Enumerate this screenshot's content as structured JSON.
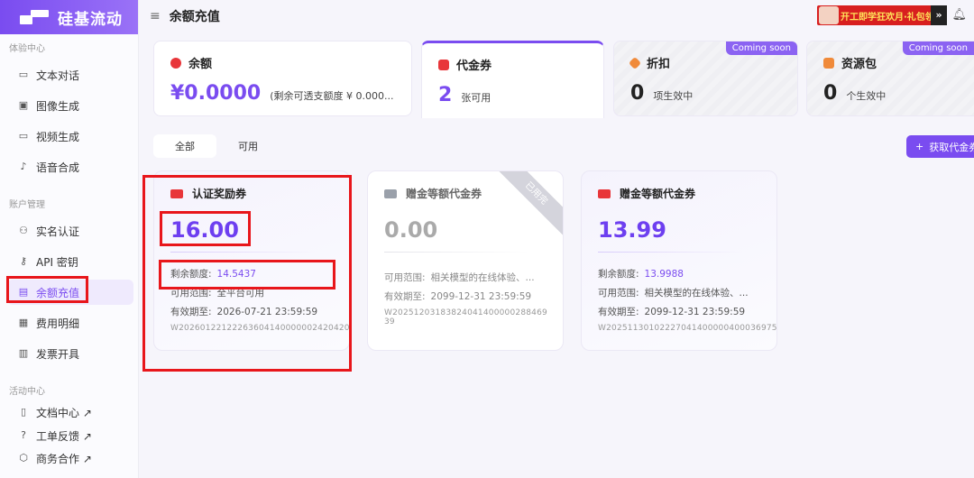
{
  "app": {
    "logo_text": "硅基流动",
    "page_title": "余额充值"
  },
  "promo": {
    "text": "开工即学狂欢月·礼包领取",
    "arrow": "»"
  },
  "sidebar": {
    "sections": [
      {
        "label": "体验中心"
      },
      {
        "label": "账户管理"
      },
      {
        "label": "活动中心"
      }
    ],
    "items": [
      {
        "label": "文本对话",
        "icon": "chat-icon"
      },
      {
        "label": "图像生成",
        "icon": "image-icon"
      },
      {
        "label": "视频生成",
        "icon": "video-icon"
      },
      {
        "label": "语音合成",
        "icon": "mic-icon"
      },
      {
        "label": "实名认证",
        "icon": "user-verify-icon"
      },
      {
        "label": "API 密钥",
        "icon": "key-icon"
      },
      {
        "label": "余额充值",
        "icon": "wallet-icon",
        "active": true
      },
      {
        "label": "费用明细",
        "icon": "bill-icon"
      },
      {
        "label": "发票开具",
        "icon": "invoice-icon"
      },
      {
        "label": "文档中心 ↗",
        "icon": "doc-icon"
      },
      {
        "label": "工单反馈 ↗",
        "icon": "help-icon"
      },
      {
        "label": "商务合作 ↗",
        "icon": "handshake-icon"
      }
    ]
  },
  "summary": {
    "balance": {
      "title": "余额",
      "amount": "¥0.0000",
      "note": "(剩余可透支额度 ¥ 0.000..."
    },
    "coupons": {
      "title": "代金券",
      "count": "2",
      "unit": "张可用"
    },
    "discount": {
      "title": "折扣",
      "count": "0",
      "unit": "项生效中",
      "badge": "Coming soon"
    },
    "package": {
      "title": "资源包",
      "count": "0",
      "unit": "个生效中",
      "badge": "Coming soon"
    }
  },
  "tabs": [
    {
      "label": "全部",
      "active": true
    },
    {
      "label": "可用"
    }
  ],
  "get_button": "获取代金券",
  "coupons": [
    {
      "title": "认证奖励券",
      "amount": "16.00",
      "remaining_label": "剩余额度:",
      "remaining": "14.5437",
      "scope_label": "可用范围:",
      "scope": "全平台可用",
      "expiry_label": "有效期至:",
      "expiry": "2026-07-21 23:59:59",
      "code": "W20260122122263604140000002420420",
      "status": "active"
    },
    {
      "title": "赠金等额代金券",
      "amount": "0.00",
      "scope_label": "可用范围:",
      "scope": "相关模型的在线体验、...",
      "expiry_label": "有效期至:",
      "expiry": "2099-12-31 23:59:59",
      "code": "W20251203183824041400000288469 39",
      "status": "used",
      "ribbon": "已用完"
    },
    {
      "title": "赠金等额代金券",
      "amount": "13.99",
      "remaining_label": "剩余额度:",
      "remaining": "13.9988",
      "scope_label": "可用范围:",
      "scope": "相关模型的在线体验、...",
      "expiry_label": "有效期至:",
      "expiry": "2099-12-31 23:59:59",
      "code": "W20251130102227041400000400036975",
      "status": "active"
    }
  ],
  "colors": {
    "accent": "#7a4cf0",
    "highlight_box": "#e8161b",
    "coupon_red": "#e8363a"
  }
}
